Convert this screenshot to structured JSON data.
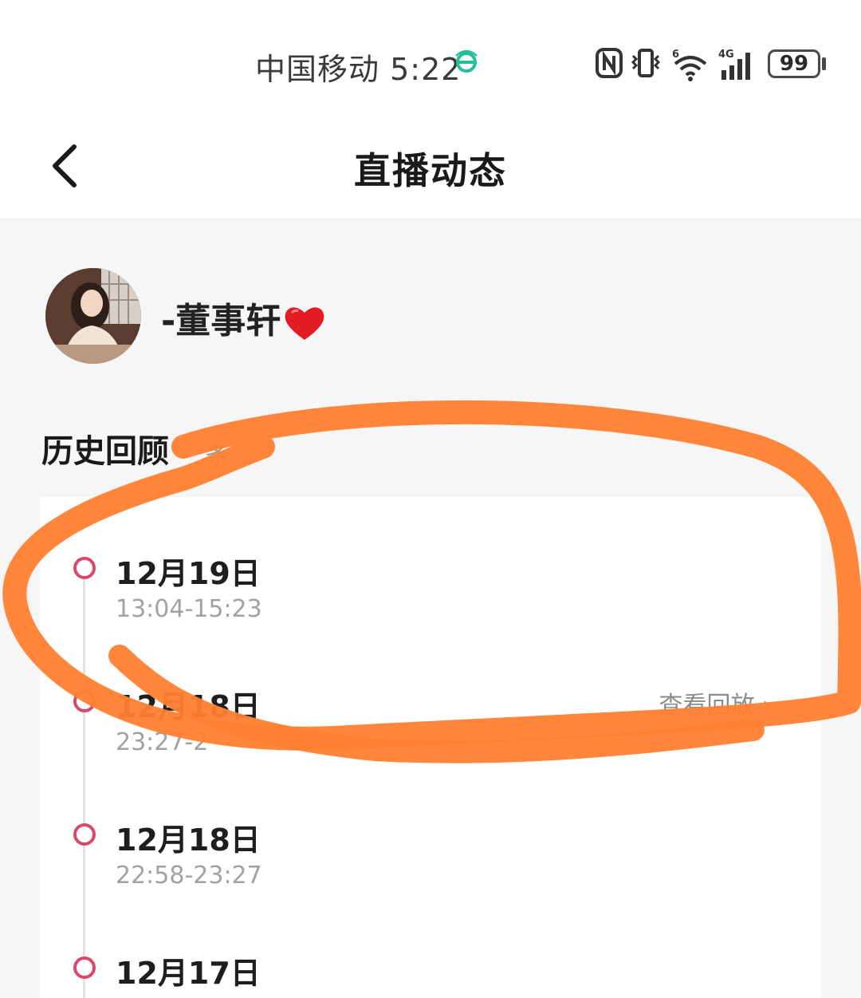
{
  "status_bar": {
    "carrier": "中国移动",
    "time": "5:22",
    "icons": [
      "nfc-icon",
      "vibrate-icon",
      "wifi-6-icon",
      "4g-signal-icon"
    ],
    "battery": "99"
  },
  "navbar": {
    "back_icon": "chevron-left-icon",
    "title": "直播动态"
  },
  "profile": {
    "name": "-董事轩",
    "name_emoji": "heart-icon"
  },
  "history": {
    "title": "历史回顾",
    "count_text": "条",
    "entries": [
      {
        "date": "12月19日",
        "time": "13:04-15:23",
        "action": ""
      },
      {
        "date": "12月18日",
        "time": "23:27-2",
        "action": "查看回放 ›"
      },
      {
        "date": "12月18日",
        "time": "22:58-23:27",
        "action": ""
      },
      {
        "date": "12月17日",
        "time": "",
        "action": ""
      }
    ]
  },
  "colors": {
    "accent": "#d9486a",
    "annotation_stroke": "#ff8030",
    "background": "#f6f6f6"
  }
}
